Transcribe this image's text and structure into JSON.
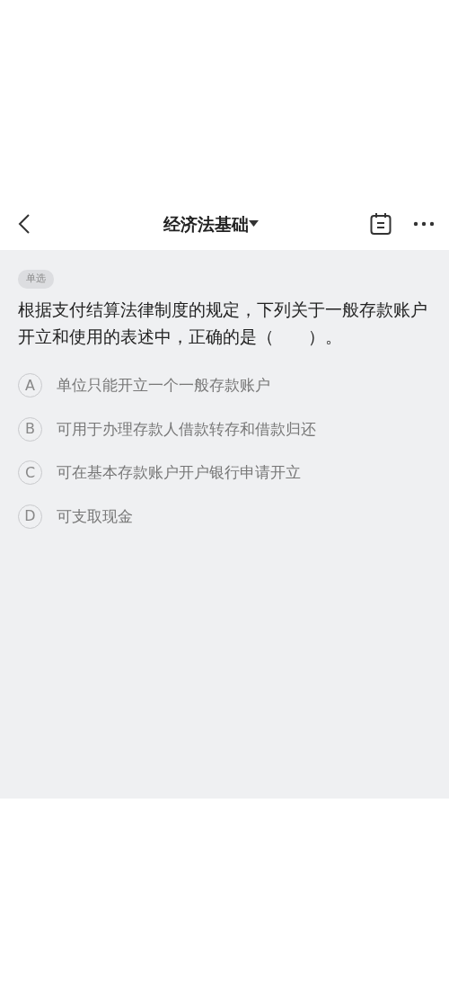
{
  "header": {
    "title": "经济法基础"
  },
  "question": {
    "type_tag": "单选",
    "text": "根据支付结算法律制度的规定，下列关于一般存款账户开立和使用的表述中，正确的是（　　）。"
  },
  "options": [
    {
      "letter": "A",
      "text": "单位只能开立一个一般存款账户"
    },
    {
      "letter": "B",
      "text": "可用于办理存款人借款转存和借款归还"
    },
    {
      "letter": "C",
      "text": "可在基本存款账户开户银行申请开立"
    },
    {
      "letter": "D",
      "text": "可支取现金"
    }
  ]
}
